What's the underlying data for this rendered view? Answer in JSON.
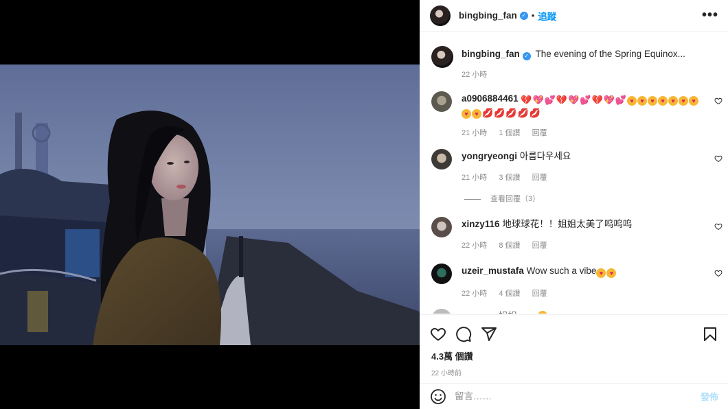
{
  "header": {
    "username": "bingbing_fan",
    "dot": "•",
    "follow_label": "追蹤",
    "more_label": "•••"
  },
  "caption": {
    "username": "bingbing_fan",
    "text": "The evening of the Spring Equinox...",
    "time": "22 小時"
  },
  "comments": [
    {
      "username": "a0906884461",
      "text": "",
      "time": "21 小時",
      "likes": "1 個讚",
      "reply": "回覆"
    },
    {
      "username": "yongryeongi",
      "text": "아름다우세요",
      "time": "21 小時",
      "likes": "3 個讚",
      "reply": "回覆",
      "view_replies": "查看回覆（3）"
    },
    {
      "username": "xinzy116",
      "text": "地球球花！！姐姐太美了呜呜呜",
      "time": "22 小時",
      "likes": "8 個讚",
      "reply": "回覆"
    },
    {
      "username": "uzeir_mustafa",
      "text": "Wow such a vibe",
      "time": "22 小時",
      "likes": "4 個讚",
      "reply": "回覆"
    },
    {
      "username": "",
      "text": "姐姐",
      "time": "",
      "likes": "",
      "reply": ""
    }
  ],
  "actions": {
    "likes": "4.3萬 個讚",
    "time_ago": "22 小時前"
  },
  "add_comment": {
    "placeholder": "留言……",
    "post_label": "發佈"
  },
  "icons": {
    "like": "heart-outline-icon",
    "comment": "speech-bubble-icon",
    "share": "paper-plane-icon",
    "save": "bookmark-icon",
    "emoji": "smiley-icon"
  },
  "colors": {
    "accent": "#0095f6",
    "verified": "#3897f0",
    "muted": "#8e8e8e"
  }
}
